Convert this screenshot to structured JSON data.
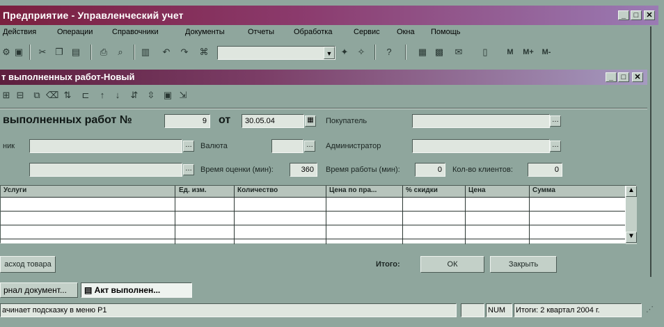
{
  "app": {
    "title": "Предприятие - Управленческий учет",
    "win_buttons": {
      "minimize": "_",
      "maximize": "□",
      "close": "✕"
    }
  },
  "menu": [
    "Действия",
    "Операции",
    "Справочники",
    "Документы",
    "Отчеты",
    "Обработка",
    "Сервис",
    "Окна",
    "Помощь"
  ],
  "toolbar": {
    "dropdown_value": "",
    "mem_labels": [
      "M",
      "M+",
      "M-"
    ]
  },
  "document": {
    "title": "т выполненных работ-Новый",
    "heading": "выполненных работ №",
    "number": "9",
    "date_label": "от",
    "date": "30.05.04",
    "fields": {
      "left1_label": "ник",
      "currency_label": "Валюта",
      "duration_label": "Время оценки (мин):",
      "duration_value": "360",
      "buyer_label": "Покупатель",
      "admin_label": "Администратор",
      "work_time_label": "Время работы (мин):",
      "work_time_value": "0",
      "clients_label": "Кол-во клиентов:",
      "clients_value": "0"
    },
    "table": {
      "headers": [
        "Услуги",
        "Ед. изм.",
        "Количество",
        "Цена по пра...",
        "% скидки",
        "Цена",
        "Сумма"
      ],
      "rows": [
        [
          "",
          "",
          "",
          "",
          "",
          "",
          ""
        ],
        [
          "",
          "",
          "",
          "",
          "",
          "",
          ""
        ],
        [
          "",
          "",
          "",
          "",
          "",
          "",
          ""
        ]
      ]
    },
    "buttons": {
      "expense": "асход товара",
      "total_label": "Итого:",
      "ok": "ОК",
      "close": "Закрыть"
    }
  },
  "tabs": [
    "рнал документ...",
    "Акт выполнен..."
  ],
  "status": {
    "message": "ачинает подсказку в меню Р1",
    "num": "NUM",
    "period": "Итоги: 2 квартал 2004 г."
  }
}
